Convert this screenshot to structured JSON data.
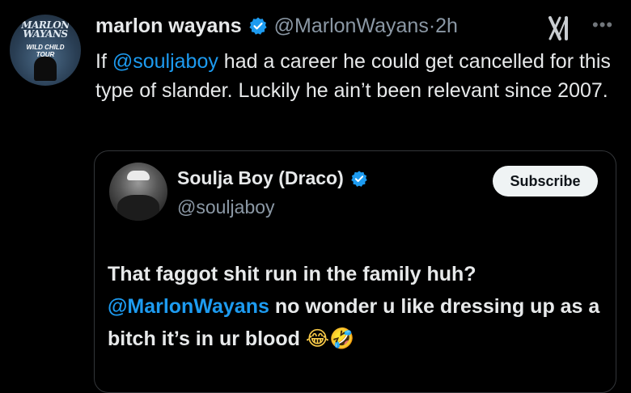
{
  "tweet": {
    "display_name": "marlon wayans",
    "handle": "@MarlonWayans",
    "separator": " · ",
    "time": "2h",
    "text_before_mention": "If ",
    "mention": "@souljaboy",
    "text_after_mention": " had a career  he could get cancelled for this type of slander. Luckily he ain’t been relevant since 2007.",
    "avatar_text_line1": "MARLON",
    "avatar_text_line2": "WAYANS",
    "avatar_text_line3": "WILD CHILD",
    "avatar_text_line4": "TOUR",
    "more_label": "•••"
  },
  "quote": {
    "display_name": "Soulja Boy (Draco)",
    "handle": "@souljaboy",
    "subscribe_label": "Subscribe",
    "text_before_mention": "That faggot shit run in the family huh?",
    "mention": "@MarlonWayans",
    "text_after_mention": " no wonder u like dressing up as a bitch it’s in ur blood ",
    "emoji": "😂🤣"
  },
  "colors": {
    "background": "#000000",
    "text": "#e7e9ea",
    "secondary_text": "#8b98a5",
    "mention": "#1d9bf0",
    "verified_badge": "#1d9bf0",
    "card_border": "#333639",
    "subscribe_bg": "#eff3f4"
  }
}
